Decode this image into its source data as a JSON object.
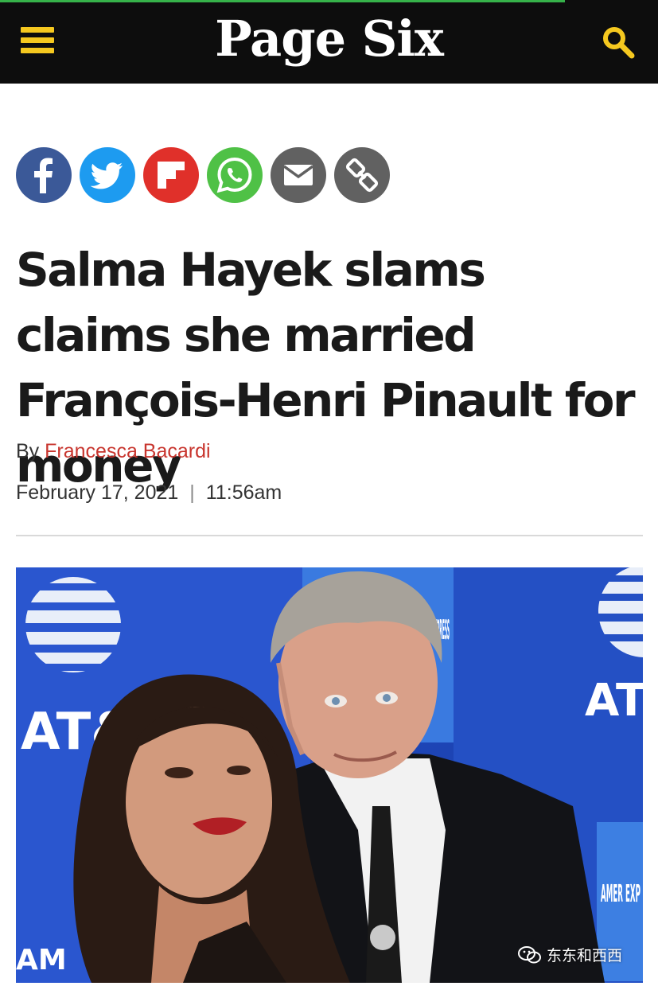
{
  "header": {
    "logo": "Page Six",
    "menu_icon": "hamburger-menu-icon",
    "search_icon": "search-icon",
    "brand_color": "#f5c81f",
    "bar_color": "#0d0d0d"
  },
  "share": [
    {
      "name": "facebook",
      "icon": "facebook-icon",
      "color": "#3b5998"
    },
    {
      "name": "twitter",
      "icon": "twitter-icon",
      "color": "#1d9bf0"
    },
    {
      "name": "flipboard",
      "icon": "flipboard-icon",
      "color": "#e0302a"
    },
    {
      "name": "whatsapp",
      "icon": "whatsapp-icon",
      "color": "#4fc146"
    },
    {
      "name": "email",
      "icon": "email-icon",
      "color": "#616161"
    },
    {
      "name": "copy-link",
      "icon": "link-icon",
      "color": "#616161"
    }
  ],
  "article": {
    "headline": "Salma Hayek slams claims she married François-Henri Pinault for money",
    "by_prefix": "By",
    "author": "Francesca Bacardi",
    "date": "February 17, 2021",
    "separator": "|",
    "time": "11:56am",
    "author_color": "#c8352e"
  },
  "photo": {
    "backdrop_logo_left": "AT&T",
    "backdrop_logo_right": "AT&T",
    "backdrop_text_1": "AMERICAN EXPRESS",
    "backdrop_text_2": "AMER EXP",
    "backdrop_text_3": "AM"
  },
  "watermark": {
    "text": "东东和西西",
    "icon": "wechat-icon"
  }
}
